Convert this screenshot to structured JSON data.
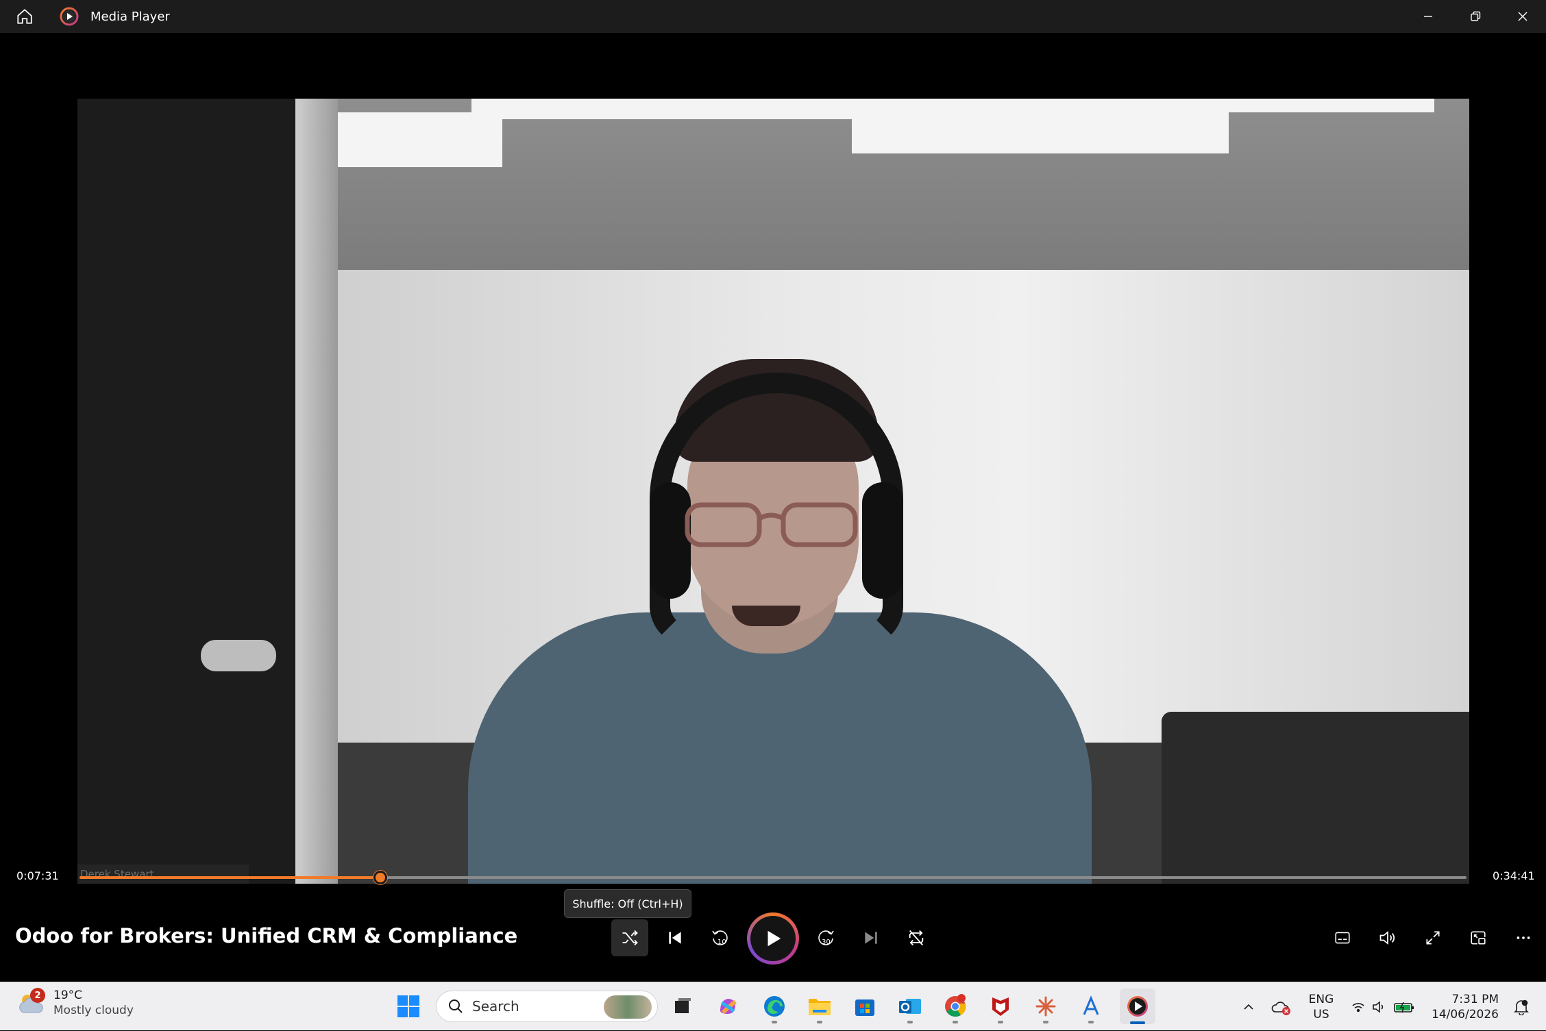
{
  "window": {
    "title": "Media Player",
    "home_icon": "home-icon",
    "app_icon": "media-player-icon",
    "controls": [
      "minimize-icon",
      "restore-icon",
      "close-icon"
    ]
  },
  "video": {
    "overlay_name": "Derek Stewart"
  },
  "playback": {
    "current_time": "0:07:31",
    "total_time": "0:34:41",
    "progress": 0.2167,
    "accent_color": "#f07b2a",
    "tooltip": "Shuffle: Off (Ctrl+H)",
    "title": "Odoo for Brokers: Unified CRM & Compliance",
    "controls": {
      "shuffle": "shuffle-icon",
      "previous": "skip-previous-icon",
      "rewind": "rewind-10-icon",
      "rewind_label": "10",
      "play": "play-icon",
      "forward": "forward-30-icon",
      "forward_label": "30",
      "next": "skip-next-icon",
      "repeat": "repeat-off-icon"
    },
    "right_controls": [
      "captions-icon",
      "volume-icon",
      "fullscreen-icon",
      "mini-player-icon",
      "more-icon"
    ]
  },
  "taskbar": {
    "weather": {
      "badge": "2",
      "temperature": "19°C",
      "condition": "Mostly cloudy"
    },
    "search_placeholder": "Search",
    "apps": [
      "start-icon",
      "search-icon",
      "task-view-icon",
      "copilot-icon",
      "edge-icon",
      "file-explorer-icon",
      "store-icon",
      "outlook-icon",
      "chrome-icon",
      "mcafee-icon",
      "claude-icon",
      "app-a-icon",
      "media-player-icon"
    ],
    "tray": {
      "language": "ENG",
      "region": "US",
      "time": "7:31 PM",
      "date": "14/06/2026"
    }
  }
}
